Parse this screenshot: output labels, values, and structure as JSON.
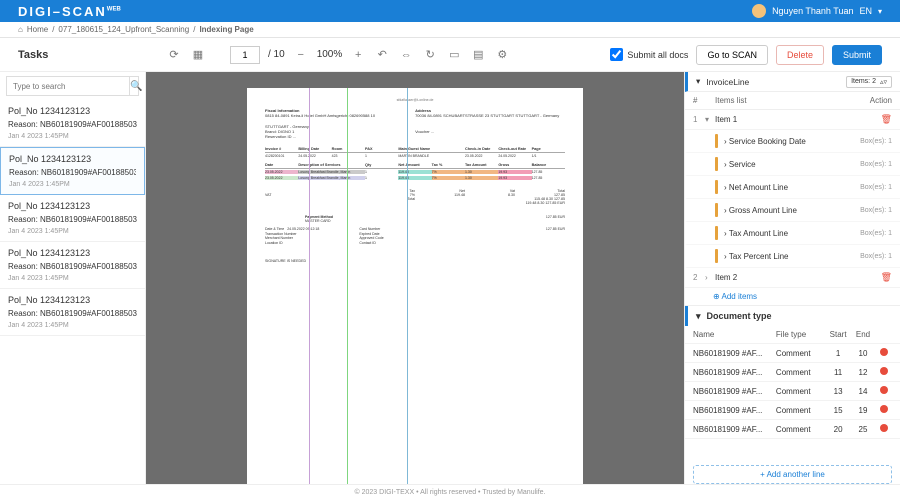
{
  "header": {
    "logo": "DIGI–SCAN",
    "user": "Nguyen Thanh Tuan",
    "lang": "EN"
  },
  "breadcrumb": {
    "home": "Home",
    "p1": "077_180615_124_Upfront_Scanning",
    "p2": "Indexing Page"
  },
  "tasks_label": "Tasks",
  "toolbar": {
    "page_current": "1",
    "page_sep": "/ 10",
    "zoom": "100%",
    "submit_all": "Submit all docs",
    "goto_scan": "Go to SCAN",
    "delete": "Delete",
    "submit": "Submit"
  },
  "search_placeholder": "Type to search",
  "tasks": [
    {
      "title": "Pol_No 1234123123",
      "reason": "Reason: NB60181909#AF00188503",
      "ts": "Jan 4 2023 1:45PM"
    },
    {
      "title": "Pol_No 1234123123",
      "reason": "Reason: NB60181909#AF00188503",
      "ts": "Jan 4 2023 1:45PM"
    },
    {
      "title": "Pol_No 1234123123",
      "reason": "Reason: NB60181909#AF00188503",
      "ts": "Jan 4 2023 1:45PM"
    },
    {
      "title": "Pol_No 1234123123",
      "reason": "Reason: NB60181909#AF00188503",
      "ts": "Jan 4 2023 1:45PM"
    },
    {
      "title": "Pol_No 1234123123",
      "reason": "Reason: NB60181909#AF00188503",
      "ts": "Jan 4 2023 1:45PM"
    }
  ],
  "doc": {
    "top_center": "sfdaflasser@t-online.de",
    "fiscal_title": "Fiscal Information",
    "fiscal_lines": "0815 84-0891\nKeira-li Hotel GmbH\nAmtsgericht 082690588 10",
    "addr_title": "Address",
    "addr_lines": "70036 84-0891\nSCHUBARTSTRASSE 23\nSTUTTGART\nSTUTTGART - Germany",
    "city": "STUTTGART - Germany",
    "brand": "Brand: DIGNO 1",
    "res": "Reservation ID ...",
    "voucher": "Voucher ...",
    "th": {
      "inv": "Invoice #",
      "bd": "Billing Date",
      "room": "Room",
      "pax": "PAX",
      "guest": "Main Guest Name",
      "cin": "Check-in Date",
      "cout": "Check-out Rate",
      "page": "Page"
    },
    "guest": "MARTIN BRANDLE",
    "cin": "23.05.2022",
    "cout": "24.05.2022",
    "pg": "1/1",
    "svc_head": {
      "date": "Date",
      "desc": "Description of Services",
      "qty": "Qty",
      "net": "Net Amount",
      "tax": "Tax %",
      "taxamt": "Tax Amount",
      "gross": "Gross",
      "bal": "Balance"
    },
    "row1": {
      "date": "23.05.2022",
      "desc": "Losung Breakfast Brandle, Martin",
      "qty": "1",
      "net": "119.48",
      "tax": "7%",
      "taxamt": "1.30",
      "gross": "19.93",
      "bal": "127.85"
    },
    "row2": {
      "date": "23.05.2022",
      "desc": "Losung Breakfast Brandle, Martin",
      "qty": "1",
      "net": "119.48",
      "tax": "7%",
      "taxamt": "1.30",
      "gross": "19.93",
      "bal": "127.85"
    },
    "tot": {
      "tax": "Tax",
      "vat_lbl": "VAT",
      "vat": "7%",
      "net": "Net",
      "netv": "119.48",
      "vatv": "Vat",
      "vatamt": "8.30",
      "total_lbl": "Total",
      "total": "127.85",
      "sum": "Total",
      "sumr": "115.48   8.30   127.85",
      "cur": "119.48   8.30   127.85  EUR"
    },
    "paym_title": "Payment Method",
    "paym_val": "MASTER CARD",
    "paym_right": "127.85 EUR",
    "meta": {
      "dt": "Date & Time",
      "dtv": "24.05.2022  09:12:18",
      "tn": "Transaction Number",
      "mn": "Merchant Number",
      "loc": "Location ID",
      "cn": "Card Number",
      "ed": "Expired Date",
      "ac": "Approved Code",
      "ct": "Contact ID"
    },
    "bottom_right": "127.85 EUR",
    "sig": "SIGNATURE IS NEEDED"
  },
  "invoiceline": {
    "title": "InvoiceLine",
    "items_badge": "Items: 2",
    "num_col": "#",
    "list_col": "Items list",
    "action_col": "Action",
    "item1": "Item 1",
    "item2": "Item 2",
    "subs": [
      {
        "name": "Service Booking Date",
        "boxes": "Box(es): 1"
      },
      {
        "name": "Service",
        "boxes": "Box(es): 1"
      },
      {
        "name": "Net Amount Line",
        "boxes": "Box(es): 1"
      },
      {
        "name": "Gross Amount Line",
        "boxes": "Box(es): 1"
      },
      {
        "name": "Tax Amount Line",
        "boxes": "Box(es): 1"
      },
      {
        "name": "Tax Percent Line",
        "boxes": "Box(es): 1"
      }
    ],
    "add_items": "Add items"
  },
  "doctype": {
    "title": "Document type",
    "cols": {
      "name": "Name",
      "ft": "File type",
      "start": "Start",
      "end": "End"
    },
    "rows": [
      {
        "name": "NB60181909 #AF...",
        "ft": "Comment",
        "s": "1",
        "e": "10"
      },
      {
        "name": "NB60181909 #AF...",
        "ft": "Comment",
        "s": "11",
        "e": "12"
      },
      {
        "name": "NB60181909 #AF...",
        "ft": "Comment",
        "s": "13",
        "e": "14"
      },
      {
        "name": "NB60181909 #AF...",
        "ft": "Comment",
        "s": "15",
        "e": "19"
      },
      {
        "name": "NB60181909 #AF...",
        "ft": "Comment",
        "s": "20",
        "e": "25"
      }
    ],
    "add": "Add another line"
  },
  "footer": "© 2023 DIGI-TEXX • All rights reserved • Trusted by Manulife."
}
